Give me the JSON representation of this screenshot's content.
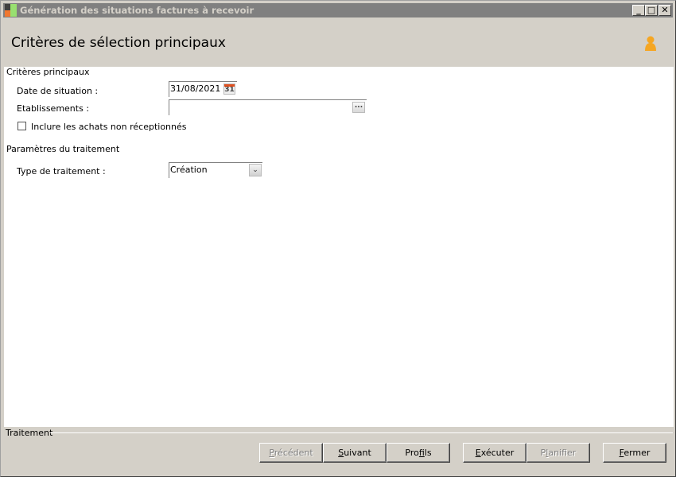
{
  "window": {
    "title": "Génération des situations factures à recevoir",
    "minimize": "_",
    "maximize": "□",
    "close": "✕"
  },
  "header": {
    "title": "Critères de sélection principaux",
    "user_icon": "person-icon"
  },
  "sections": {
    "main": {
      "title": "Critères principaux",
      "date_label": "Date de situation :",
      "date_value": "31/08/2021",
      "calendar_icon_text": "31",
      "etab_label": "Etablissements :",
      "etab_value": "",
      "browse_text": "...",
      "include_label": "Inclure les achats non réceptionnés",
      "include_checked": false
    },
    "params": {
      "title": "Paramètres du traitement",
      "type_label": "Type de traitement :",
      "type_value": "Création"
    }
  },
  "footer": {
    "label": "Traitement",
    "buttons": [
      {
        "label": "Précédent",
        "accel": 0,
        "enabled": false
      },
      {
        "label": "Suivant",
        "accel": 0,
        "enabled": true
      },
      {
        "label": "Profils",
        "accel": 3,
        "enabled": true
      },
      {
        "label": "Exécuter",
        "accel": 0,
        "enabled": true
      },
      {
        "label": "Planifier",
        "accel": 1,
        "enabled": false
      },
      {
        "label": "Fermer",
        "accel": 0,
        "enabled": true
      }
    ]
  }
}
